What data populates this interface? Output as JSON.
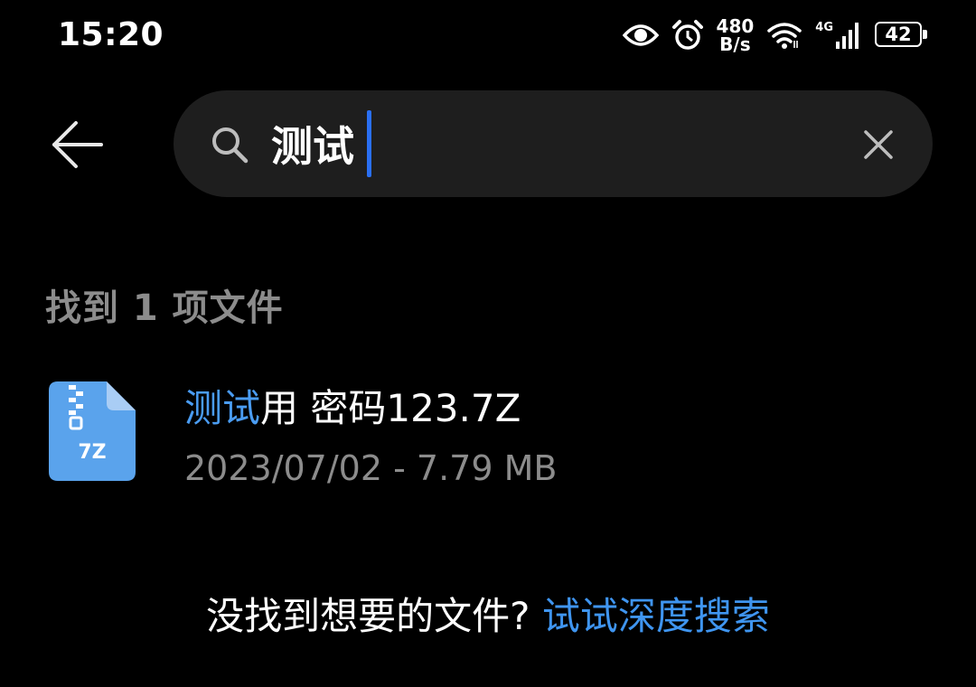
{
  "status_bar": {
    "time": "15:20",
    "net_speed_value": "480",
    "net_speed_unit": "B/s",
    "network_type": "4G",
    "battery_level": "42"
  },
  "search": {
    "query": "测试",
    "placeholder": ""
  },
  "results": {
    "count_label": "找到 1 项文件",
    "files": [
      {
        "icon_label": "7Z",
        "name_highlight": "测试",
        "name_rest": "用 密码123.7Z",
        "meta": "2023/07/02 - 7.79 MB"
      }
    ]
  },
  "footer": {
    "prompt": "没找到想要的文件? ",
    "link": "试试深度搜索"
  },
  "colors": {
    "accent": "#2a6ff3",
    "highlight": "#4a9cf2",
    "link": "#3f95f0",
    "file_icon": "#5aa3ec",
    "background": "#000000",
    "search_bg": "#1e1e1e",
    "secondary_text": "#8c8c8c"
  }
}
